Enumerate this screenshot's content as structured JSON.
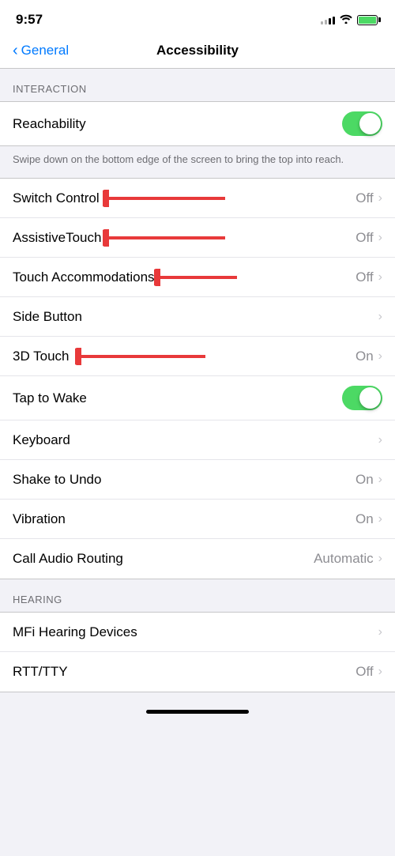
{
  "statusBar": {
    "time": "9:57"
  },
  "navBar": {
    "backLabel": "General",
    "title": "Accessibility"
  },
  "sections": [
    {
      "id": "interaction",
      "header": "INTERACTION",
      "items": [
        {
          "id": "reachability",
          "label": "Reachability",
          "type": "toggle",
          "value": "on",
          "hasArrow": false
        },
        {
          "id": "reachability-desc",
          "type": "description",
          "text": "Swipe down on the bottom edge of the screen to bring the top into reach."
        },
        {
          "id": "switch-control",
          "label": "Switch Control",
          "type": "nav",
          "value": "Off",
          "hasArrow": true,
          "redArrow": true
        },
        {
          "id": "assistive-touch",
          "label": "AssistiveTouch",
          "type": "nav",
          "value": "Off",
          "hasArrow": true,
          "redArrow": true
        },
        {
          "id": "touch-accommodations",
          "label": "Touch Accommodations",
          "type": "nav",
          "value": "Off",
          "hasArrow": true,
          "redArrow": true
        },
        {
          "id": "side-button",
          "label": "Side Button",
          "type": "nav",
          "value": "",
          "hasArrow": true,
          "redArrow": false
        },
        {
          "id": "3d-touch",
          "label": "3D Touch",
          "type": "nav",
          "value": "On",
          "hasArrow": true,
          "redArrow": true
        },
        {
          "id": "tap-to-wake",
          "label": "Tap to Wake",
          "type": "toggle",
          "value": "on",
          "hasArrow": false,
          "redArrow": false
        },
        {
          "id": "keyboard",
          "label": "Keyboard",
          "type": "nav",
          "value": "",
          "hasArrow": true,
          "redArrow": false
        },
        {
          "id": "shake-to-undo",
          "label": "Shake to Undo",
          "type": "nav",
          "value": "On",
          "hasArrow": true,
          "redArrow": false
        },
        {
          "id": "vibration",
          "label": "Vibration",
          "type": "nav",
          "value": "On",
          "hasArrow": true,
          "redArrow": false
        },
        {
          "id": "call-audio-routing",
          "label": "Call Audio Routing",
          "type": "nav",
          "value": "Automatic",
          "hasArrow": true,
          "redArrow": false
        }
      ]
    },
    {
      "id": "hearing",
      "header": "HEARING",
      "items": [
        {
          "id": "mfi-hearing-devices",
          "label": "MFi Hearing Devices",
          "type": "nav",
          "value": "",
          "hasArrow": true,
          "redArrow": false
        },
        {
          "id": "rtt-tty",
          "label": "RTT/TTY",
          "type": "nav",
          "value": "Off",
          "hasArrow": true,
          "redArrow": false,
          "hasHomeBar": true
        }
      ]
    }
  ]
}
